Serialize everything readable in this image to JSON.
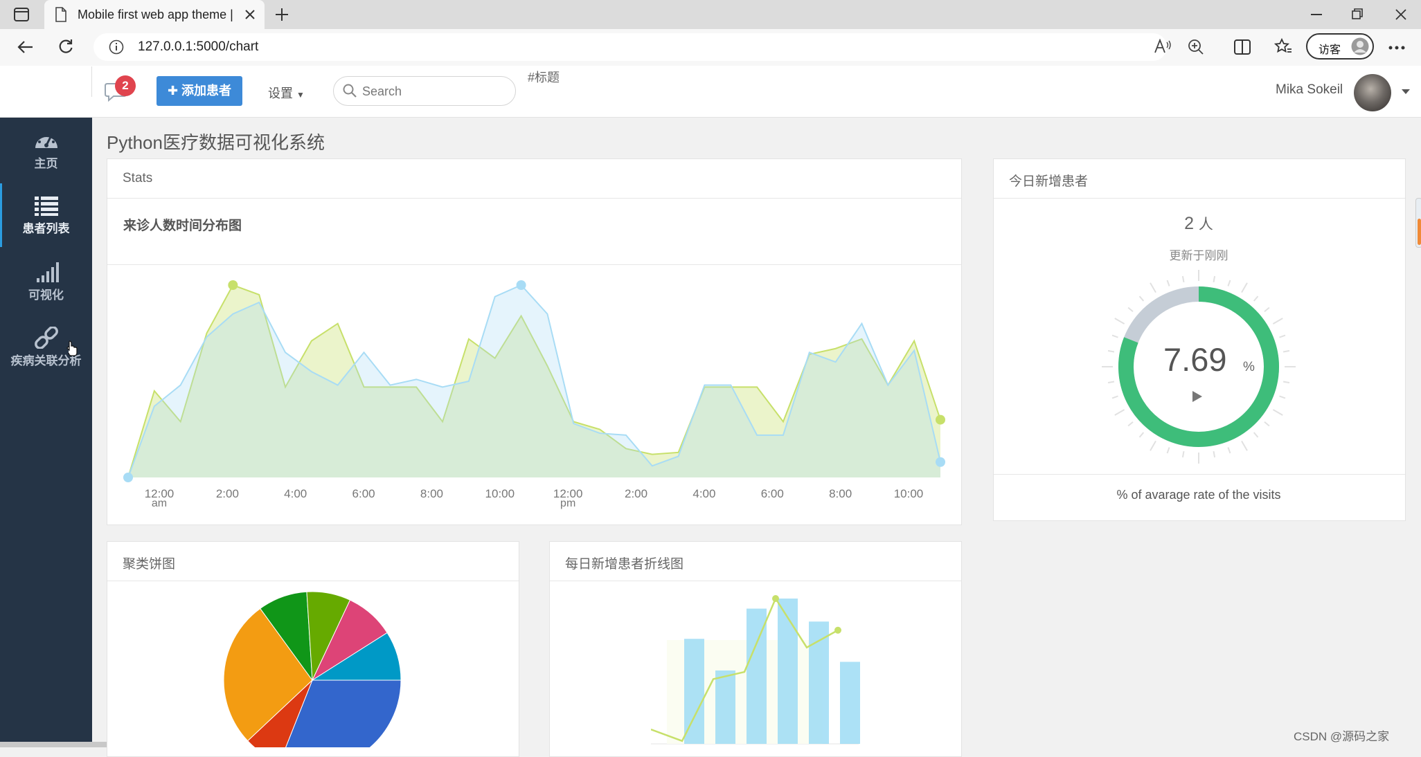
{
  "browser": {
    "tab_title": "Mobile first web app theme | first",
    "url": "127.0.0.1:5000/chart",
    "guest_label": "访客"
  },
  "topbar": {
    "message_badge": "2",
    "add_patient_label": "添加患者",
    "settings_label": "设置",
    "search_placeholder": "Search",
    "title_hashtag": "#标题",
    "username": "Mika Sokeil"
  },
  "sidebar": {
    "items": [
      {
        "label": "主页",
        "icon": "dashboard-icon"
      },
      {
        "label": "患者列表",
        "icon": "list-icon"
      },
      {
        "label": "可视化",
        "icon": "signal-bars-icon"
      },
      {
        "label": "疾病关联分析",
        "icon": "link-icon"
      }
    ]
  },
  "page": {
    "title": "Python医疗数据可视化系统"
  },
  "stats_panel": {
    "title": "Stats",
    "subtitle": "来诊人数时间分布图"
  },
  "new_patients_panel": {
    "title": "今日新增患者",
    "count": "2",
    "unit": "人",
    "updated": "更新于刚刚",
    "gauge_value": "7.69",
    "gauge_unit": "%",
    "footer": "% of avarage rate of the visits"
  },
  "pie_panel": {
    "title": "聚类饼图"
  },
  "line_panel": {
    "title": "每日新增患者折线图"
  },
  "watermark": "CSDN @源码之家",
  "colors": {
    "sidebar_bg": "#253446",
    "accent_blue": "#3d8ad8",
    "gauge_green": "#3ebd7a",
    "gauge_grey": "#c5cdd6",
    "badge_red": "#e0444e"
  },
  "chart_data": [
    {
      "type": "area",
      "title": "来诊人数时间分布图",
      "x_ticks": [
        "12:00 am",
        "2:00",
        "4:00",
        "6:00",
        "8:00",
        "10:00",
        "12:00 pm",
        "2:00",
        "4:00",
        "6:00",
        "8:00",
        "10:00"
      ],
      "ylim": [
        0,
        100
      ],
      "series": [
        {
          "color": "#c7e06a",
          "values": [
            0,
            45,
            29,
            75,
            100,
            95,
            47,
            71,
            80,
            47,
            47,
            47,
            29,
            72,
            62,
            84,
            58,
            29,
            25,
            15,
            12,
            13,
            47,
            47,
            47,
            29,
            64,
            67,
            72,
            48,
            71,
            30
          ]
        },
        {
          "color": "#a8dcf5",
          "values": [
            0,
            37,
            48,
            73,
            85,
            91,
            65,
            55,
            48,
            65,
            48,
            51,
            47,
            50,
            94,
            100,
            85,
            28,
            23,
            22,
            6,
            11,
            48,
            48,
            22,
            22,
            65,
            60,
            80,
            48,
            66,
            8
          ]
        }
      ]
    },
    {
      "type": "gauge",
      "value": 7.69,
      "unit": "%"
    },
    {
      "type": "pie",
      "title": "聚类饼图",
      "slices": [
        {
          "value": 31,
          "color": "#3366cc"
        },
        {
          "value": 7,
          "color": "#dc3912"
        },
        {
          "value": 27,
          "color": "#f39c12"
        },
        {
          "value": 9,
          "color": "#109618"
        },
        {
          "value": 8,
          "color": "#66aa00"
        },
        {
          "value": 9,
          "color": "#dd4477"
        },
        {
          "value": 9,
          "color": "#0099c6"
        }
      ]
    },
    {
      "type": "bar",
      "title": "每日新增患者折线图",
      "bars": [
        73,
        51,
        94,
        101,
        85,
        57
      ],
      "line": [
        10,
        2,
        45,
        50,
        101,
        67,
        79
      ],
      "bar_color": "#9edcf4",
      "line_color": "#c7e06a"
    }
  ]
}
